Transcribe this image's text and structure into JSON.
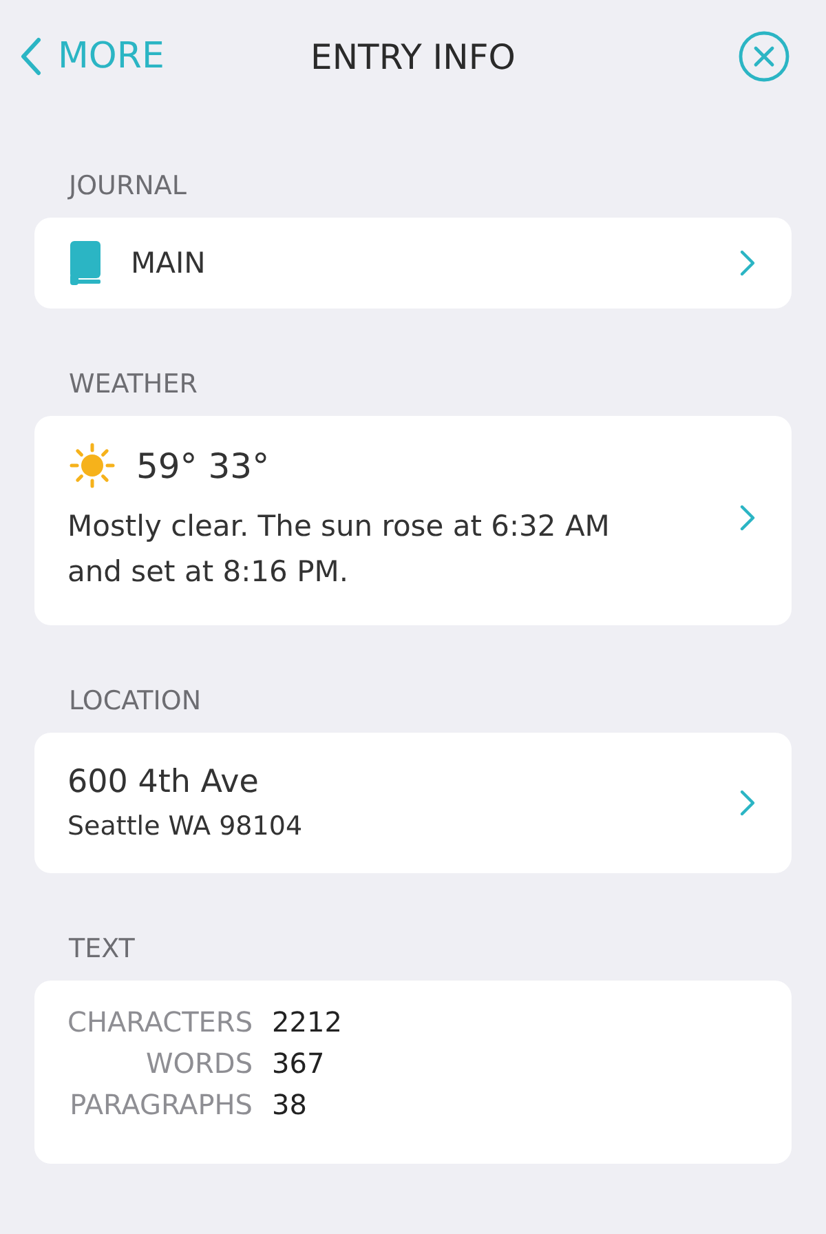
{
  "nav": {
    "back": "MORE",
    "title": "ENTRY INFO"
  },
  "journal": {
    "label": "JOURNAL",
    "name": "MAIN"
  },
  "weather": {
    "label": "WEATHER",
    "temps": "59° 33°",
    "summary": "Mostly clear.  The sun rose at 6:32 AM and set at 8:16 PM."
  },
  "location": {
    "label": "LOCATION",
    "street": "600 4th Ave",
    "city": "Seattle WA 98104"
  },
  "text": {
    "label": "TEXT",
    "stats": [
      {
        "name": "CHARACTERS",
        "value": "2212"
      },
      {
        "name": "WORDS",
        "value": "367"
      },
      {
        "name": "PARAGRAPHS",
        "value": "38"
      }
    ]
  }
}
